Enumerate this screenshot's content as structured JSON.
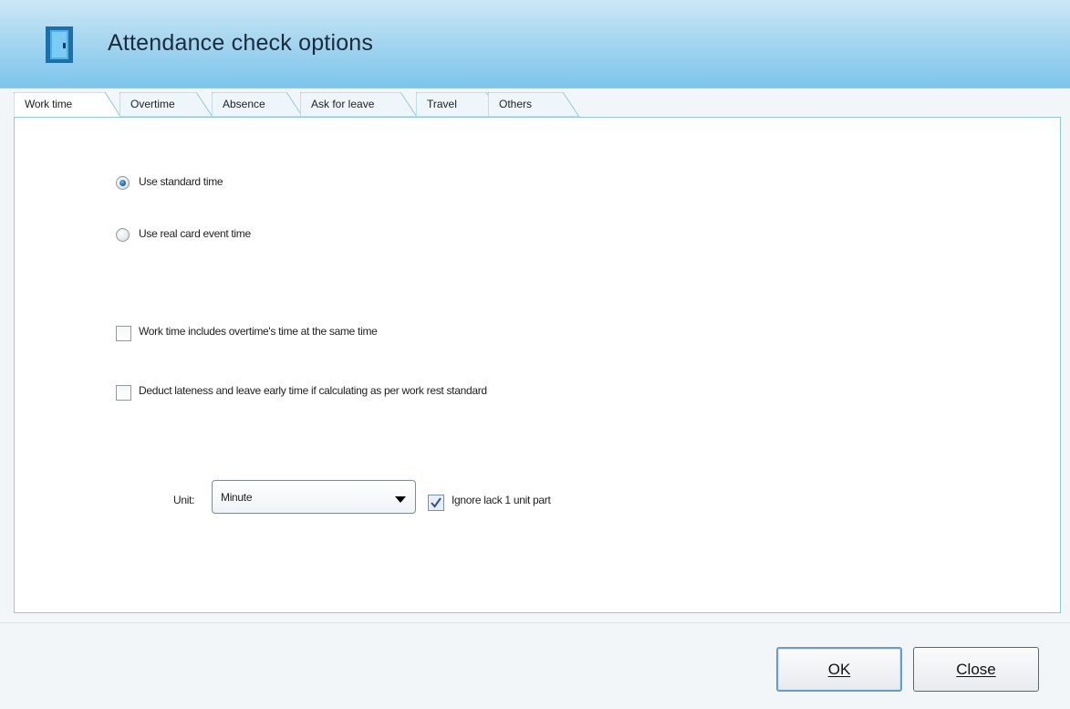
{
  "window": {
    "title": "Attendance check options",
    "icon": "door-icon"
  },
  "tabs": [
    {
      "label": "Work time",
      "active": true
    },
    {
      "label": "Overtime",
      "active": false
    },
    {
      "label": "Absence",
      "active": false
    },
    {
      "label": "Ask for leave",
      "active": false
    },
    {
      "label": "Travel",
      "active": false
    },
    {
      "label": "Others",
      "active": false
    }
  ],
  "options": {
    "radio_standard": {
      "label": "Use standard time",
      "checked": true
    },
    "radio_real": {
      "label": "Use real card event time",
      "checked": false
    },
    "check_overtime": {
      "label": "Work time includes overtime's time at the same time",
      "checked": false
    },
    "check_deduct": {
      "label": "Deduct lateness and leave early time if calculating as per work rest standard",
      "checked": false
    }
  },
  "unit": {
    "label": "Unit:",
    "selected": "Minute",
    "ignore_label": "Ignore lack 1 unit part",
    "ignore_checked": true
  },
  "buttons": {
    "ok": "OK",
    "close": "Close"
  },
  "colors": {
    "title_gradient": "#7cc5ec",
    "panel_border": "#8fc8e3",
    "ok_border": "#6b9cc6"
  }
}
